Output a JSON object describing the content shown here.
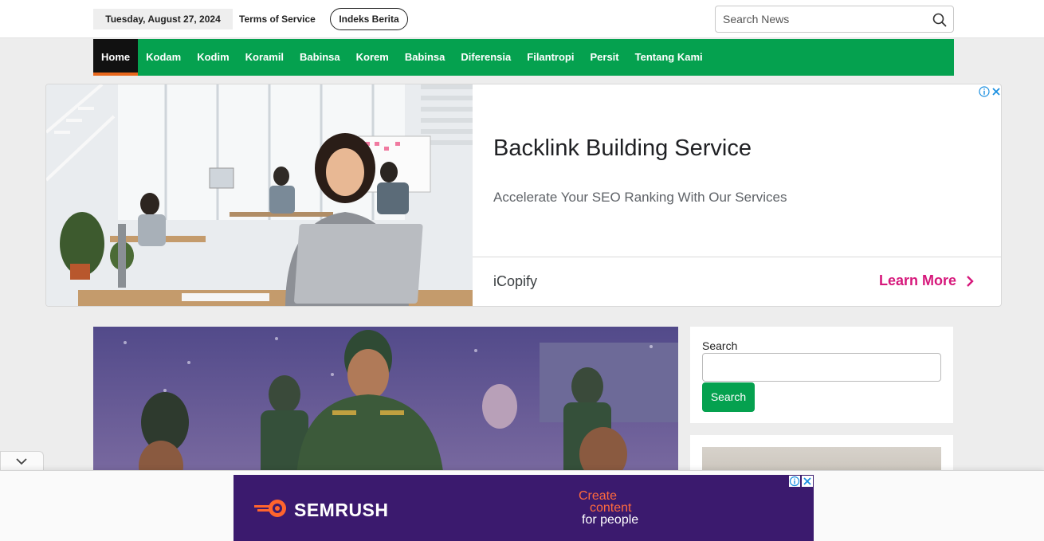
{
  "topbar": {
    "date": "Tuesday, August 27, 2024",
    "terms_link": "Terms of Service",
    "indeks_button": "Indeks Berita",
    "search_placeholder": "Search News"
  },
  "nav": {
    "items": [
      "Home",
      "Kodam",
      "Kodim",
      "Koramil",
      "Babinsa",
      "Korem",
      "Babinsa",
      "Diferensia",
      "Filantropi",
      "Persit",
      "Tentang Kami"
    ],
    "active_index": 0
  },
  "ad_top": {
    "headline": "Backlink Building Service",
    "description": "Accelerate Your SEO Ranking With Our Services",
    "advertiser": "iCopify",
    "cta": "Learn More",
    "cta_color": "#d6187b"
  },
  "sidebar": {
    "search_label": "Search",
    "search_button": "Search"
  },
  "bottom_ad": {
    "brand": "SEMRUSH",
    "tagline_1": "Create",
    "tagline_2": "content",
    "tagline_3": "for people",
    "background": "#3b1a6e",
    "accent": "#ff6a3d"
  },
  "colors": {
    "brand_green": "#05a14f",
    "active_underline": "#e8671c",
    "page_background": "#ededed"
  }
}
